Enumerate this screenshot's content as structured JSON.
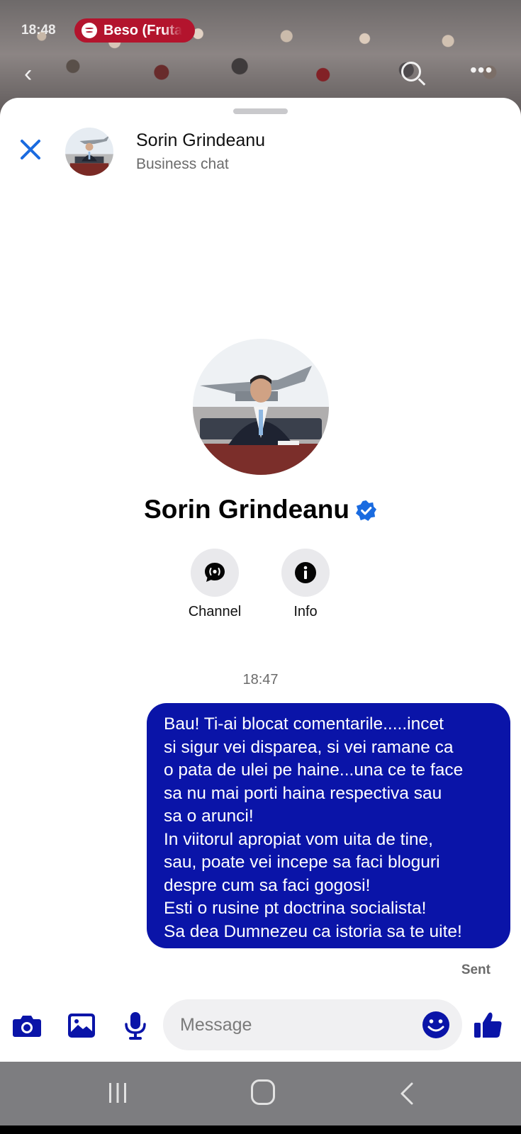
{
  "background_app": {
    "status_time": "18:48",
    "now_playing": "Beso (Fruta"
  },
  "header": {
    "title": "Sorin Grindeanu",
    "subtitle": "Business chat"
  },
  "profile": {
    "name": "Sorin Grindeanu",
    "verified": true,
    "actions": [
      {
        "label": "Channel",
        "icon": "channel-icon"
      },
      {
        "label": "Info",
        "icon": "info-icon"
      }
    ]
  },
  "conversation": {
    "timestamp": "18:47",
    "messages": [
      {
        "direction": "outgoing",
        "text": "Bau! Ti-ai blocat comentarile.....incet\nsi sigur vei disparea, si vei ramane ca\no pata de ulei pe haine...una ce te face\nsa nu mai porti haina respectiva sau\nsa o arunci!\nIn viitorul apropiat vom uita de tine,\nsau, poate vei incepe sa faci bloguri\ndespre cum sa faci gogosi!\nEsti o rusine pt doctrina socialista!\nSa dea Dumnezeu ca istoria sa te uite!",
        "status": "Sent"
      }
    ]
  },
  "composer": {
    "placeholder": "Message",
    "value": ""
  },
  "colors": {
    "accent": "#0a14a8",
    "close_blue": "#1a6be0",
    "music_pill": "#b3142d"
  }
}
